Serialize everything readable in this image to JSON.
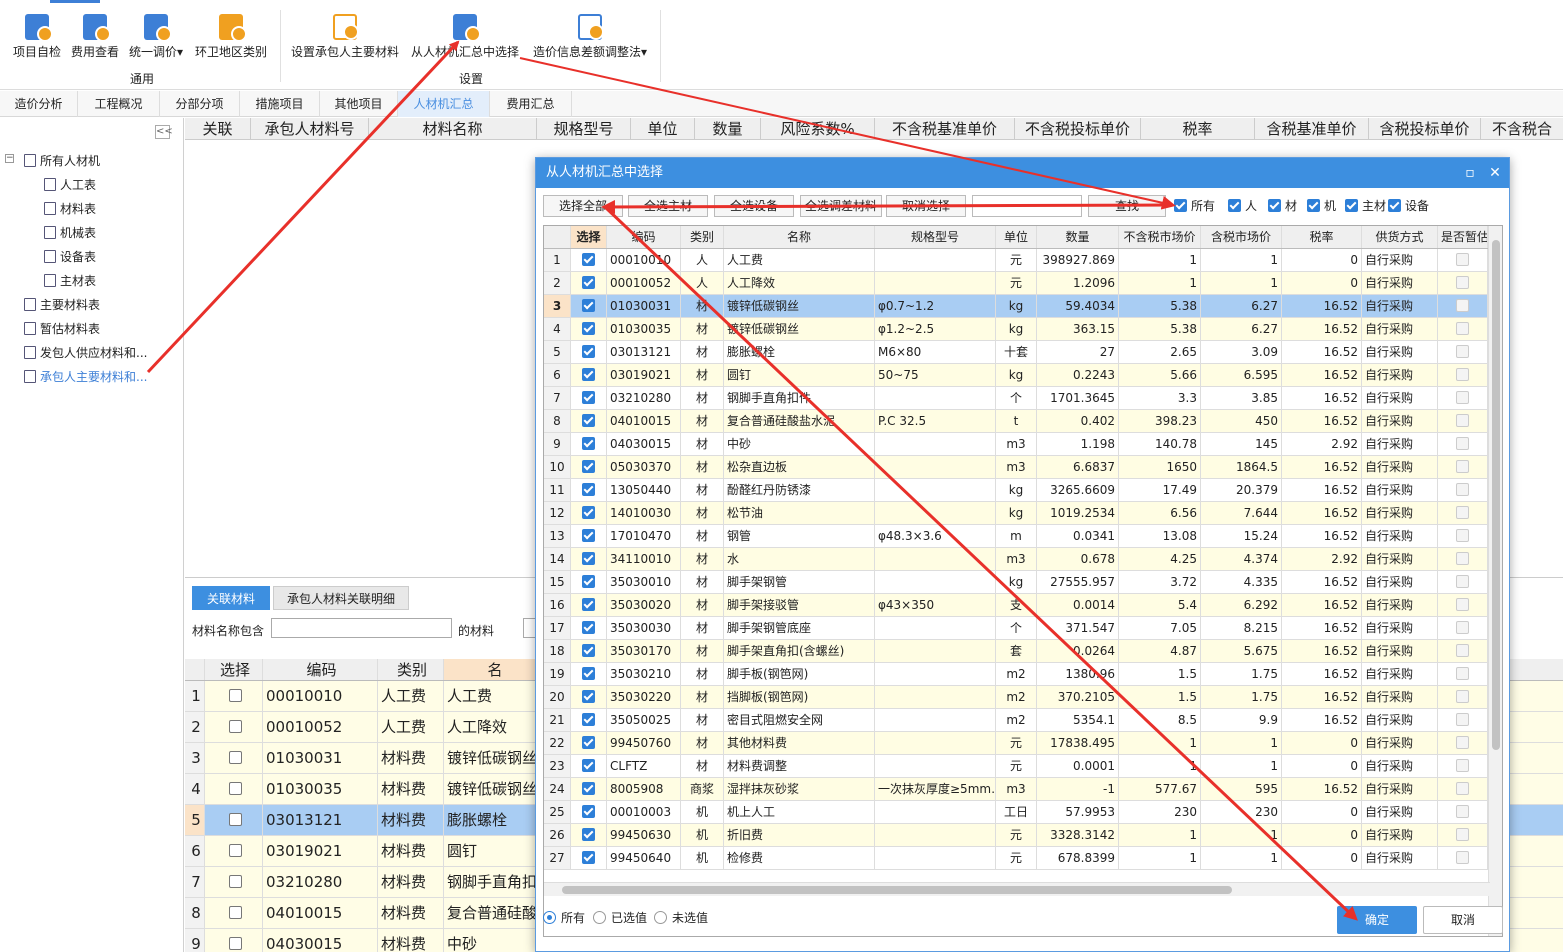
{
  "ribbon": {
    "buttons": [
      {
        "label": "项目自检",
        "icon": "project-check-icon",
        "color": "#3d7fd6"
      },
      {
        "label": "费用查看",
        "icon": "cost-view-icon",
        "color": "#3d7fd6"
      },
      {
        "label": "统一调价",
        "icon": "unified-price-icon",
        "color": "#3d7fd6",
        "dropdown": "▾"
      },
      {
        "label": "环卫地区类别",
        "icon": "region-category-icon",
        "color": "#f0a020"
      },
      {
        "label": "设置承包人主要材料",
        "icon": "settings-gear-icon",
        "color": "#f0a020"
      },
      {
        "label": "从人材机汇总中选择",
        "icon": "sum-select-icon",
        "color": "#3d7fd6"
      },
      {
        "label": "造价信息差额调整法",
        "icon": "price-info-adjust-icon",
        "color": "#3d7fd6",
        "dropdown": "▾"
      }
    ],
    "groups": [
      "通用",
      "设置"
    ]
  },
  "tabs": [
    {
      "label": "造价分析"
    },
    {
      "label": "工程概况"
    },
    {
      "label": "分部分项"
    },
    {
      "label": "措施项目"
    },
    {
      "label": "其他项目"
    },
    {
      "label": "人材机汇总",
      "active": true
    },
    {
      "label": "费用汇总"
    }
  ],
  "tree": {
    "collapse": "<<",
    "nodes": [
      {
        "label": "所有人材机",
        "level": 0
      },
      {
        "label": "人工表",
        "level": 1
      },
      {
        "label": "材料表",
        "level": 1
      },
      {
        "label": "机械表",
        "level": 1
      },
      {
        "label": "设备表",
        "level": 1
      },
      {
        "label": "主材表",
        "level": 1
      },
      {
        "label": "主要材料表",
        "level": 0
      },
      {
        "label": "暂估材料表",
        "level": 0
      },
      {
        "label": "发包人供应材料和...",
        "level": 0
      },
      {
        "label": "承包人主要材料和...",
        "level": 0,
        "selected": true
      }
    ]
  },
  "main_grid": {
    "columns": [
      "关联",
      "承包人材料号",
      "材料名称",
      "规格型号",
      "单位",
      "数量",
      "风险系数%",
      "不含税基准单价",
      "不含税投标单价",
      "税率",
      "含税基准单价",
      "含税投标单价",
      "不含税合"
    ]
  },
  "lower": {
    "tabs": [
      "关联材料",
      "承包人材料关联明细"
    ],
    "filter_label": "材料名称包含",
    "filter_suffix": "的材料",
    "columns": [
      "选择",
      "编码",
      "类别",
      "名"
    ],
    "rows": [
      {
        "no": "1",
        "code": "00010010",
        "type": "人工费",
        "name": "人工费"
      },
      {
        "no": "2",
        "code": "00010052",
        "type": "人工费",
        "name": "人工降效"
      },
      {
        "no": "3",
        "code": "01030031",
        "type": "材料费",
        "name": "镀锌低碳钢丝"
      },
      {
        "no": "4",
        "code": "01030035",
        "type": "材料费",
        "name": "镀锌低碳钢丝"
      },
      {
        "no": "5",
        "code": "03013121",
        "type": "材料费",
        "name": "膨胀螺栓",
        "selected": true
      },
      {
        "no": "6",
        "code": "03019021",
        "type": "材料费",
        "name": "圆钉"
      },
      {
        "no": "7",
        "code": "03210280",
        "type": "材料费",
        "name": "钢脚手直角扣"
      },
      {
        "no": "8",
        "code": "04010015",
        "type": "材料费",
        "name": "复合普通硅酸"
      },
      {
        "no": "9",
        "code": "04030015",
        "type": "材料费",
        "name": "中砂"
      }
    ]
  },
  "modal": {
    "title": "从人材机汇总中选择",
    "toolbar": [
      "选择全部",
      "全选主材",
      "全选设备",
      "全选调差材料",
      "取消选择"
    ],
    "search_button": "查找",
    "filters": [
      "所有",
      "人",
      "材",
      "机",
      "主材",
      "设备"
    ],
    "columns": [
      "选择",
      "编码",
      "类别",
      "名称",
      "规格型号",
      "单位",
      "数量",
      "不含税市场价",
      "含税市场价",
      "税率",
      "供货方式",
      "是否暂估"
    ],
    "rows": [
      {
        "no": "1",
        "code": "00010010",
        "type": "人",
        "name": "人工费",
        "spec": "",
        "unit": "元",
        "qty": "398927.869",
        "price": "1",
        "taxprice": "1",
        "tax": "0",
        "supply": "自行采购"
      },
      {
        "no": "2",
        "code": "00010052",
        "type": "人",
        "name": "人工降效",
        "spec": "",
        "unit": "元",
        "qty": "1.2096",
        "price": "1",
        "taxprice": "1",
        "tax": "0",
        "supply": "自行采购"
      },
      {
        "no": "3",
        "code": "01030031",
        "type": "材",
        "name": "镀锌低碳钢丝",
        "spec": "φ0.7~1.2",
        "unit": "kg",
        "qty": "59.4034",
        "price": "5.38",
        "taxprice": "6.27",
        "tax": "16.52",
        "supply": "自行采购",
        "selected": true
      },
      {
        "no": "4",
        "code": "01030035",
        "type": "材",
        "name": "镀锌低碳钢丝",
        "spec": "φ1.2~2.5",
        "unit": "kg",
        "qty": "363.15",
        "price": "5.38",
        "taxprice": "6.27",
        "tax": "16.52",
        "supply": "自行采购"
      },
      {
        "no": "5",
        "code": "03013121",
        "type": "材",
        "name": "膨胀螺栓",
        "spec": "M6×80",
        "unit": "十套",
        "qty": "27",
        "price": "2.65",
        "taxprice": "3.09",
        "tax": "16.52",
        "supply": "自行采购"
      },
      {
        "no": "6",
        "code": "03019021",
        "type": "材",
        "name": "圆钉",
        "spec": "50~75",
        "unit": "kg",
        "qty": "0.2243",
        "price": "5.66",
        "taxprice": "6.595",
        "tax": "16.52",
        "supply": "自行采购"
      },
      {
        "no": "7",
        "code": "03210280",
        "type": "材",
        "name": "钢脚手直角扣件",
        "spec": "",
        "unit": "个",
        "qty": "1701.3645",
        "price": "3.3",
        "taxprice": "3.85",
        "tax": "16.52",
        "supply": "自行采购"
      },
      {
        "no": "8",
        "code": "04010015",
        "type": "材",
        "name": "复合普通硅酸盐水泥",
        "spec": "P.C 32.5",
        "unit": "t",
        "qty": "0.402",
        "price": "398.23",
        "taxprice": "450",
        "tax": "16.52",
        "supply": "自行采购"
      },
      {
        "no": "9",
        "code": "04030015",
        "type": "材",
        "name": "中砂",
        "spec": "",
        "unit": "m3",
        "qty": "1.198",
        "price": "140.78",
        "taxprice": "145",
        "tax": "2.92",
        "supply": "自行采购"
      },
      {
        "no": "10",
        "code": "05030370",
        "type": "材",
        "name": "松杂直边板",
        "spec": "",
        "unit": "m3",
        "qty": "6.6837",
        "price": "1650",
        "taxprice": "1864.5",
        "tax": "16.52",
        "supply": "自行采购"
      },
      {
        "no": "11",
        "code": "13050440",
        "type": "材",
        "name": "酚醛红丹防锈漆",
        "spec": "",
        "unit": "kg",
        "qty": "3265.6609",
        "price": "17.49",
        "taxprice": "20.379",
        "tax": "16.52",
        "supply": "自行采购"
      },
      {
        "no": "12",
        "code": "14010030",
        "type": "材",
        "name": "松节油",
        "spec": "",
        "unit": "kg",
        "qty": "1019.2534",
        "price": "6.56",
        "taxprice": "7.644",
        "tax": "16.52",
        "supply": "自行采购"
      },
      {
        "no": "13",
        "code": "17010470",
        "type": "材",
        "name": "钢管",
        "spec": "φ48.3×3.6",
        "unit": "m",
        "qty": "0.0341",
        "price": "13.08",
        "taxprice": "15.24",
        "tax": "16.52",
        "supply": "自行采购"
      },
      {
        "no": "14",
        "code": "34110010",
        "type": "材",
        "name": "水",
        "spec": "",
        "unit": "m3",
        "qty": "0.678",
        "price": "4.25",
        "taxprice": "4.374",
        "tax": "2.92",
        "supply": "自行采购"
      },
      {
        "no": "15",
        "code": "35030010",
        "type": "材",
        "name": "脚手架钢管",
        "spec": "",
        "unit": "kg",
        "qty": "27555.957",
        "price": "3.72",
        "taxprice": "4.335",
        "tax": "16.52",
        "supply": "自行采购"
      },
      {
        "no": "16",
        "code": "35030020",
        "type": "材",
        "name": "脚手架接驳管",
        "spec": "φ43×350",
        "unit": "支",
        "qty": "0.0014",
        "price": "5.4",
        "taxprice": "6.292",
        "tax": "16.52",
        "supply": "自行采购"
      },
      {
        "no": "17",
        "code": "35030030",
        "type": "材",
        "name": "脚手架钢管底座",
        "spec": "",
        "unit": "个",
        "qty": "371.547",
        "price": "7.05",
        "taxprice": "8.215",
        "tax": "16.52",
        "supply": "自行采购"
      },
      {
        "no": "18",
        "code": "35030170",
        "type": "材",
        "name": "脚手架直角扣(含螺丝)",
        "spec": "",
        "unit": "套",
        "qty": "0.0264",
        "price": "4.87",
        "taxprice": "5.675",
        "tax": "16.52",
        "supply": "自行采购"
      },
      {
        "no": "19",
        "code": "35030210",
        "type": "材",
        "name": "脚手板(钢笆网)",
        "spec": "",
        "unit": "m2",
        "qty": "1380.96",
        "price": "1.5",
        "taxprice": "1.75",
        "tax": "16.52",
        "supply": "自行采购"
      },
      {
        "no": "20",
        "code": "35030220",
        "type": "材",
        "name": "挡脚板(钢笆网)",
        "spec": "",
        "unit": "m2",
        "qty": "370.2105",
        "price": "1.5",
        "taxprice": "1.75",
        "tax": "16.52",
        "supply": "自行采购"
      },
      {
        "no": "21",
        "code": "35050025",
        "type": "材",
        "name": "密目式阻燃安全网",
        "spec": "",
        "unit": "m2",
        "qty": "5354.1",
        "price": "8.5",
        "taxprice": "9.9",
        "tax": "16.52",
        "supply": "自行采购"
      },
      {
        "no": "22",
        "code": "99450760",
        "type": "材",
        "name": "其他材料费",
        "spec": "",
        "unit": "元",
        "qty": "17838.495",
        "price": "1",
        "taxprice": "1",
        "tax": "0",
        "supply": "自行采购"
      },
      {
        "no": "23",
        "code": "CLFTZ",
        "type": "材",
        "name": "材料费调整",
        "spec": "",
        "unit": "元",
        "qty": "0.0001",
        "price": "1",
        "taxprice": "1",
        "tax": "0",
        "supply": "自行采购"
      },
      {
        "no": "24",
        "code": "8005908",
        "type": "商浆",
        "name": "湿拌抹灰砂浆",
        "spec": "一次抹灰厚度≥5mm…",
        "unit": "m3",
        "qty": "-1",
        "price": "577.67",
        "taxprice": "595",
        "tax": "16.52",
        "supply": "自行采购"
      },
      {
        "no": "25",
        "code": "00010003",
        "type": "机",
        "name": "机上人工",
        "spec": "",
        "unit": "工日",
        "qty": "57.9953",
        "price": "230",
        "taxprice": "230",
        "tax": "0",
        "supply": "自行采购"
      },
      {
        "no": "26",
        "code": "99450630",
        "type": "机",
        "name": "折旧费",
        "spec": "",
        "unit": "元",
        "qty": "3328.3142",
        "price": "1",
        "taxprice": "1",
        "tax": "0",
        "supply": "自行采购"
      },
      {
        "no": "27",
        "code": "99450640",
        "type": "机",
        "name": "检修费",
        "spec": "",
        "unit": "元",
        "qty": "678.8399",
        "price": "1",
        "taxprice": "1",
        "tax": "0",
        "supply": "自行采购"
      }
    ],
    "radio": [
      "所有",
      "已选值",
      "未选值"
    ],
    "ok": "确定",
    "cancel": "取消"
  },
  "colors": {
    "accent": "#3d8fe0",
    "selection": "#a9cdf3",
    "row_alt": "#fffde3",
    "arrow": "#e8302a"
  }
}
